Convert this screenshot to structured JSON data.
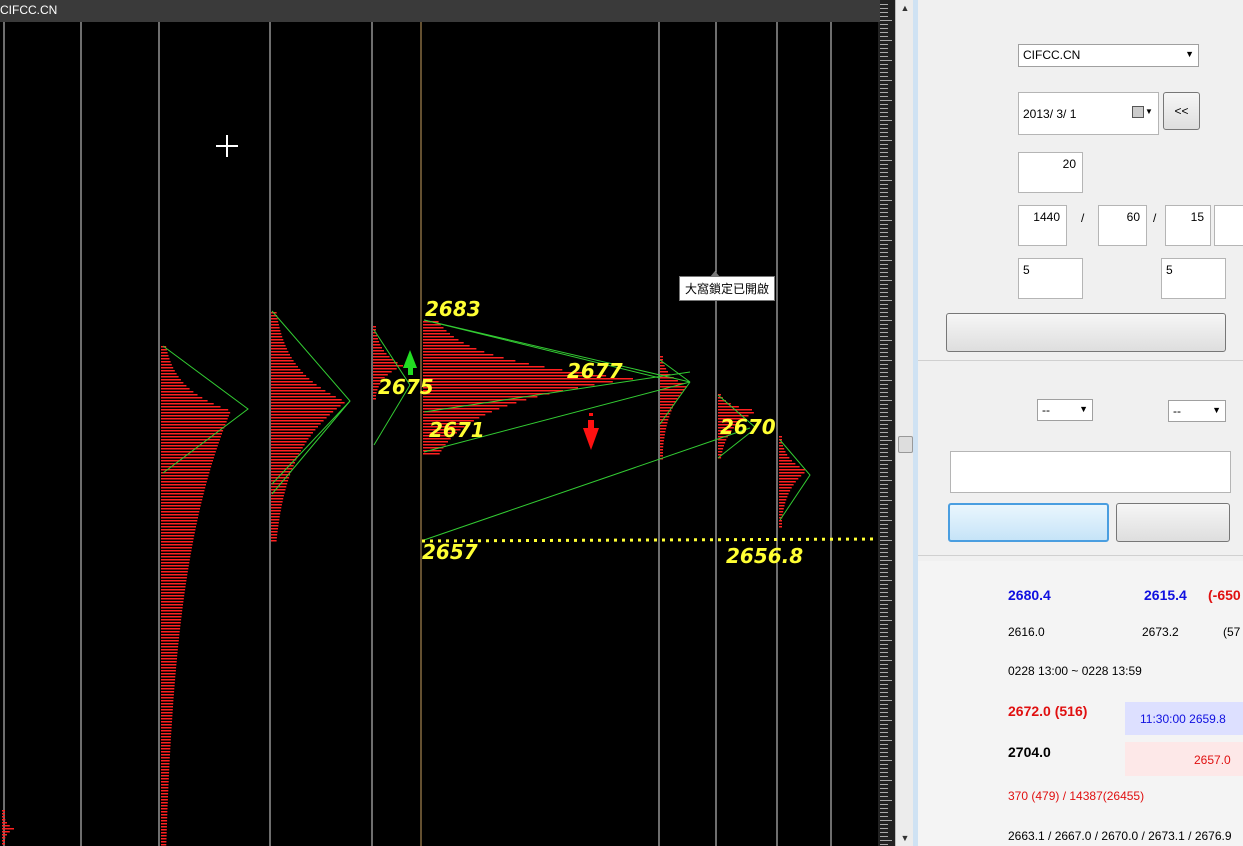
{
  "chart": {
    "symbol": "CIFCC.CN",
    "tooltip": "大窩鎖定已開啟",
    "price_labels": [
      {
        "name": "label-2683",
        "text": "2683"
      },
      {
        "name": "label-2675",
        "text": "2675"
      },
      {
        "name": "label-2677",
        "text": "2677"
      },
      {
        "name": "label-2671",
        "text": "2671"
      },
      {
        "name": "label-2670",
        "text": "2670"
      },
      {
        "name": "label-2657",
        "text": "2657"
      },
      {
        "name": "label-2656-8",
        "text": "2656.8"
      }
    ],
    "colors": {
      "background": "#000000",
      "profile": "#ff2020",
      "trendline": "#33cc33",
      "label": "#ffff33",
      "up_arrow": "#22dd22",
      "down_arrow": "#ff1111"
    }
  },
  "panel": {
    "symbol_select": "CIFCC.CN",
    "date_value": "2013/  3/  1",
    "back_button": "<<",
    "count_value": "20",
    "period_1": "1440",
    "period_2": "60",
    "period_3": "15",
    "slash": "/",
    "param_1": "5",
    "param_2": "5",
    "select_1": "--",
    "select_2": "--",
    "stats": {
      "high": "2680.4",
      "low": "2615.4",
      "change": "(-650",
      "open": "2616.0",
      "close": "2673.2",
      "close_extra": "(57",
      "time_range": "0228 13:00 ~ 0228 13:59",
      "poc": "2672.0 (516)",
      "time_price": "11:30:00  2659.8",
      "level": "2704.0",
      "level_red": "2657.0",
      "volume": "370 (479) / 14387(26455)",
      "levels_list": "2663.1 / 2667.0 / 2670.0 / 2673.1 / 2676.9"
    }
  }
}
